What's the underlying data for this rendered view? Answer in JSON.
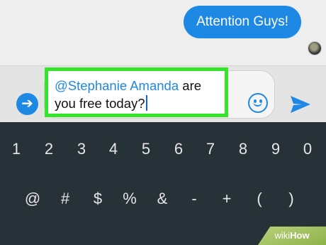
{
  "chat": {
    "sent_message": "Attention Guys!"
  },
  "composer": {
    "mention": "@Stephanie Amanda",
    "message_text": " are you free today?"
  },
  "keyboard": {
    "row1": [
      "1",
      "2",
      "3",
      "4",
      "5",
      "6",
      "7",
      "8",
      "9",
      "0"
    ],
    "row2": [
      "@",
      "#",
      "$",
      "%",
      "&",
      "-",
      "+",
      "(",
      ")"
    ]
  },
  "watermark": {
    "prefix": "wiki",
    "suffix": "How"
  },
  "colors": {
    "accent": "#1e88e5",
    "highlight": "#34e52a",
    "keyboard_bg": "#263238"
  },
  "icons": {
    "expand": "arrow-right-circle-icon",
    "emoji": "smiley-icon",
    "send": "send-icon"
  }
}
